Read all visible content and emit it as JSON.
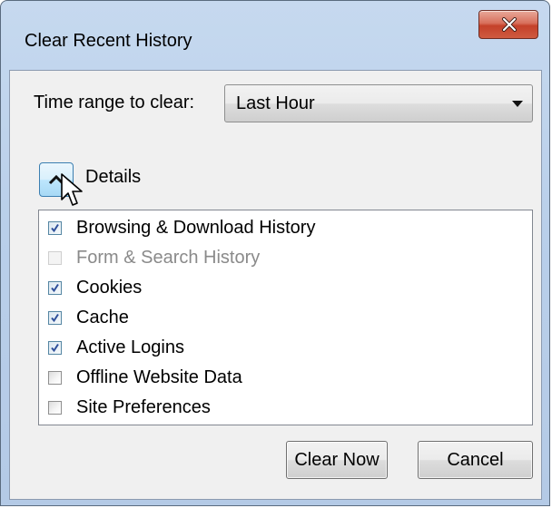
{
  "window": {
    "title": "Clear Recent History"
  },
  "time_range": {
    "label": "Time range to clear:",
    "selected": "Last Hour"
  },
  "details": {
    "label": "Details",
    "expanded": true
  },
  "items": [
    {
      "label": "Browsing & Download History",
      "checked": true,
      "enabled": true
    },
    {
      "label": "Form & Search History",
      "checked": false,
      "enabled": false
    },
    {
      "label": "Cookies",
      "checked": true,
      "enabled": true
    },
    {
      "label": "Cache",
      "checked": true,
      "enabled": true
    },
    {
      "label": "Active Logins",
      "checked": true,
      "enabled": true
    },
    {
      "label": "Offline Website Data",
      "checked": false,
      "enabled": true
    },
    {
      "label": "Site Preferences",
      "checked": false,
      "enabled": true
    }
  ],
  "buttons": {
    "clear_now": "Clear Now",
    "cancel": "Cancel"
  },
  "icons": {
    "close": "close-icon",
    "dropdown": "chevron-down-icon",
    "details_toggle": "chevron-up-icon",
    "cursor": "mouse-pointer-icon",
    "check": "checkmark-icon"
  },
  "colors": {
    "frame": "#b9cfea",
    "client": "#f0f0f0",
    "close_button": "#c4412a",
    "toggle_hover": "#bee6fd",
    "check_mark": "#2f4f9a"
  }
}
